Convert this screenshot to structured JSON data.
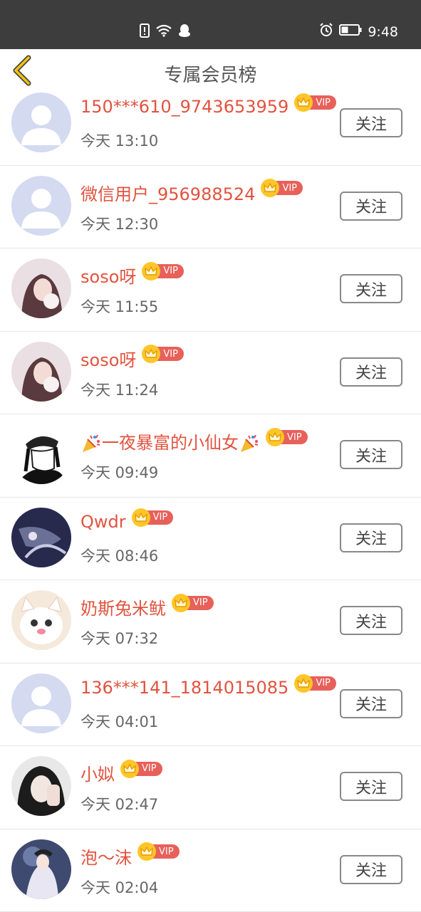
{
  "status_bar": {
    "time": "9:48"
  },
  "header": {
    "title": "专属会员榜"
  },
  "vip_label": "VIP",
  "follow_label": "关注",
  "members": [
    {
      "name": "150***610_9743653959",
      "time": "今天 13:10",
      "avatar": "default"
    },
    {
      "name": "微信用户_956988524",
      "time": "今天 12:30",
      "avatar": "default"
    },
    {
      "name": "soso呀",
      "time": "今天 11:55",
      "avatar": "photo"
    },
    {
      "name": "soso呀",
      "time": "今天 11:24",
      "avatar": "photo"
    },
    {
      "name_prefix_emoji": "party-popper",
      "name": "一夜暴富的小仙女",
      "name_suffix_emoji": "party-popper",
      "time": "今天 09:49",
      "avatar": "photo"
    },
    {
      "name": "Qwdr",
      "time": "今天 08:46",
      "avatar": "photo"
    },
    {
      "name": "奶斯兔米鱿",
      "time": "今天 07:32",
      "avatar": "photo"
    },
    {
      "name": "136***141_1814015085",
      "time": "今天 04:01",
      "avatar": "default"
    },
    {
      "name": "小姒",
      "time": "今天 02:47",
      "avatar": "photo"
    },
    {
      "name": "泡～沫",
      "time": "今天 02:04",
      "avatar": "photo"
    }
  ]
}
